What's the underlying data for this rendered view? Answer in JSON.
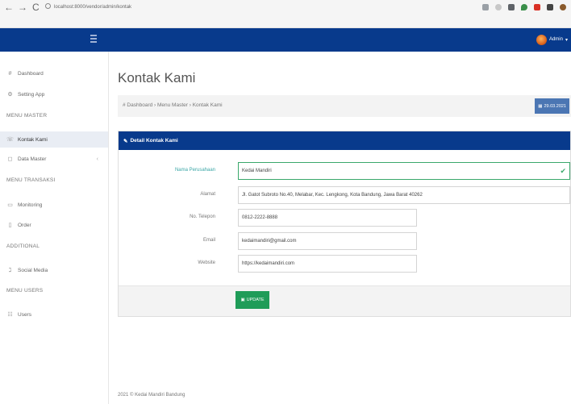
{
  "browser": {
    "url": "localhost:8000/vendor/admin/kontak",
    "nav": {
      "back": "←",
      "forward": "→",
      "reload": "C"
    },
    "extension_icons": [
      "translate-icon",
      "star-icon",
      "extension-icon",
      "location-icon",
      "red-extension-icon",
      "puzzle-icon",
      "profile-icon"
    ]
  },
  "topbar": {
    "admin_label": "Admin",
    "caret": "▾"
  },
  "sidebar": {
    "items": [
      {
        "label": "Dashboard",
        "icon": "#"
      },
      {
        "label": "Setting App",
        "icon": "⚙"
      },
      {
        "label": "Kontak Kami",
        "icon": "☏"
      },
      {
        "label": "Data Master",
        "icon": "◻",
        "caret": "‹"
      },
      {
        "label": "Monitoring",
        "icon": "▭"
      },
      {
        "label": "Order",
        "icon": "▯"
      },
      {
        "label": "Social Media",
        "icon": "ℷ"
      },
      {
        "label": "Users",
        "icon": "☷"
      }
    ],
    "headers": [
      "MENU MASTER",
      "MENU TRANSAKSI",
      "ADDITIONAL",
      "MENU USERS"
    ]
  },
  "page": {
    "title": "Kontak Kami",
    "breadcrumb": "# Dashboard  ›  Menu Master  ›  Kontak Kami",
    "badge": "29.03.2021"
  },
  "panel": {
    "title": "Detail Kontak Kami",
    "fields": [
      {
        "label": "Nama Perusahaan",
        "value": "Kedai Mandiri"
      },
      {
        "label": "Alamat",
        "value": "Jl. Gatot Subroto No.40, Melabar, Kec. Lengkong, Kota Bandung, Jawa Barat 40262"
      },
      {
        "label": "No. Telepon",
        "value": "0812-2222-8888"
      },
      {
        "label": "Email",
        "value": "kedaimandiri@gmail.com"
      },
      {
        "label": "Website",
        "value": "https://kedaimandiri.com"
      }
    ],
    "update_button": "UPDATE"
  },
  "footer": "2021 © Kedai Mandiri Bandung",
  "colors": {
    "navbar": "#083a8c",
    "success": "#1f9c58",
    "badge": "#4b76b3"
  }
}
